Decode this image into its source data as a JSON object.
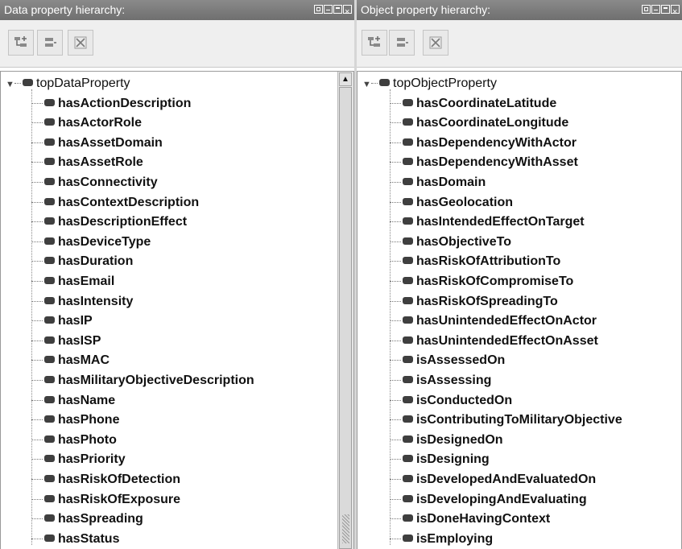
{
  "left_panel": {
    "title": "Data property hierarchy:",
    "root": "topDataProperty",
    "items": [
      "hasActionDescription",
      "hasActorRole",
      "hasAssetDomain",
      "hasAssetRole",
      "hasConnectivity",
      "hasContextDescription",
      "hasDescriptionEffect",
      "hasDeviceType",
      "hasDuration",
      "hasEmail",
      "hasIntensity",
      "hasIP",
      "hasISP",
      "hasMAC",
      "hasMilitaryObjectiveDescription",
      "hasName",
      "hasPhone",
      "hasPhoto",
      "hasPriority",
      "hasRiskOfDetection",
      "hasRiskOfExposure",
      "hasSpreading",
      "hasStatus"
    ]
  },
  "right_panel": {
    "title": "Object property hierarchy:",
    "root": "topObjectProperty",
    "items": [
      "hasCoordinateLatitude",
      "hasCoordinateLongitude",
      "hasDependencyWithActor",
      "hasDependencyWithAsset",
      "hasDomain",
      "hasGeolocation",
      "hasIntendedEffectOnTarget",
      "hasObjectiveTo",
      "hasRiskOfAttributionTo",
      "hasRiskOfCompromiseTo",
      "hasRiskOfSpreadingTo",
      "hasUnintendedEffectOnActor",
      "hasUnintendedEffectOnAsset",
      "isAssessedOn",
      "isAssessing",
      "isConductedOn",
      "isContributingToMilitaryObjective",
      "isDesignedOn",
      "isDesigning",
      "isDevelopedAndEvaluatedOn",
      "isDevelopingAndEvaluating",
      "isDoneHavingContext",
      "isEmploying"
    ]
  },
  "toolbar_icons": [
    "add-subproperty-icon",
    "add-sibling-icon",
    "delete-icon"
  ],
  "window_controls": [
    "restore-icon",
    "minimize-icon",
    "maximize-icon",
    "close-icon"
  ],
  "colors": {
    "title_bar": "#7a7a7a",
    "toolbar": "#efefef",
    "bullet": "#3f3f3f"
  }
}
